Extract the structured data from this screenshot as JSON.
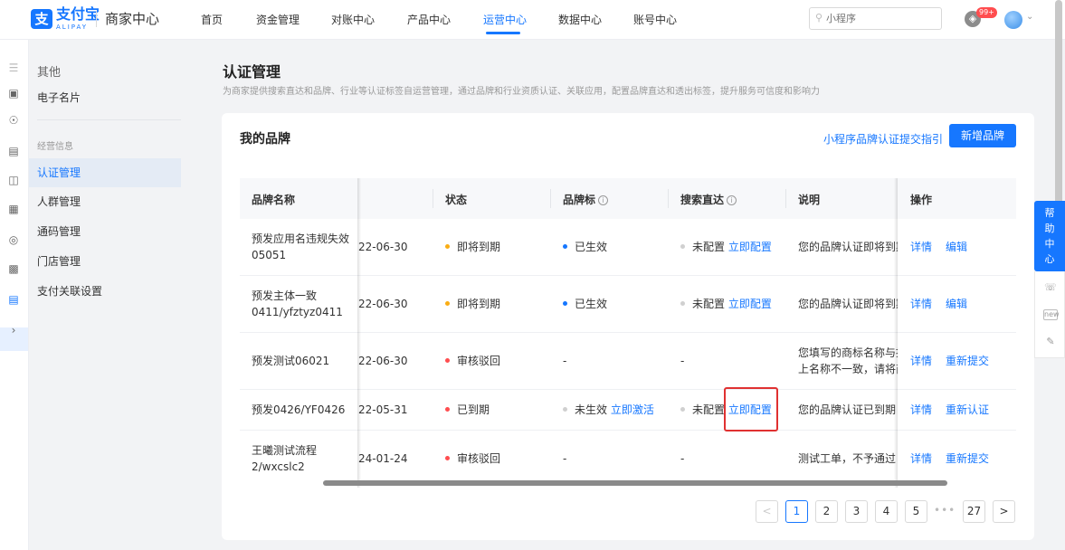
{
  "brand": {
    "logo_glyph": "支",
    "logo_name": "支付宝",
    "logo_sub": "ALIPAY",
    "console": "商家中心"
  },
  "nav": {
    "items": [
      "首页",
      "资金管理",
      "对账中心",
      "产品中心",
      "运营中心",
      "数据中心",
      "账号中心"
    ],
    "active": "运营中心",
    "search_placeholder": "小程序",
    "notification_badge": "99+"
  },
  "sidebar": {
    "header": "其他",
    "top_item": "电子名片",
    "group_label": "经营信息",
    "items": [
      "认证管理",
      "人群管理",
      "通码管理",
      "门店管理",
      "支付关联设置"
    ],
    "active": "认证管理"
  },
  "page": {
    "title": "认证管理",
    "description": "为商家提供搜索直达和品牌、行业等认证标签自运营管理，通过品牌和行业资质认证、关联应用，配置品牌直达和透出标签，提升服务可信度和影响力"
  },
  "card": {
    "title": "我的品牌",
    "guide_link": "小程序品牌认证提交指引",
    "add_button": "新增品牌"
  },
  "table": {
    "headers": {
      "name": "品牌名称",
      "status": "状态",
      "badge": "品牌标",
      "search": "搜索直达",
      "note": "说明",
      "ops": "操作"
    },
    "rows": [
      {
        "name1": "预发应用名违规失效",
        "name2": "05051",
        "date": "22-06-30",
        "status": "即将到期",
        "badge_status": "已生效",
        "badge_action": "",
        "search_status": "未配置",
        "search_action": "立即配置",
        "note1": "您的品牌认证即将到期",
        "note2": "",
        "op1": "详情",
        "op2": "编辑"
      },
      {
        "name1": "预发主体一致",
        "name2": "0411/yfztyz0411",
        "date": "22-06-30",
        "status": "即将到期",
        "badge_status": "已生效",
        "badge_action": "",
        "search_status": "未配置",
        "search_action": "立即配置",
        "note1": "您的品牌认证即将到期",
        "note2": "",
        "op1": "详情",
        "op2": "编辑"
      },
      {
        "name1": "预发测试06021",
        "name2": "",
        "date": "22-06-30",
        "status": "审核驳回",
        "badge_status": "-",
        "badge_action": "",
        "search_status": "-",
        "search_action": "",
        "note1": "您填写的商标名称与提",
        "note2": "上名称不一致，请将商",
        "op1": "详情",
        "op2": "重新提交"
      },
      {
        "name1": "预发0426/YF0426",
        "name2": "",
        "date": "22-05-31",
        "status": "已到期",
        "badge_status": "未生效",
        "badge_action": "立即激活",
        "search_status": "未配置",
        "search_action": "立即配置",
        "note1": "您的品牌认证已到期",
        "note2": "",
        "op1": "详情",
        "op2": "重新认证"
      },
      {
        "name1": "王曦测试流程",
        "name2": "2/wxcslc2",
        "date": "24-01-24",
        "status": "审核驳回",
        "badge_status": "-",
        "badge_action": "",
        "search_status": "-",
        "search_action": "",
        "note1": "测试工单，不予通过",
        "note2": "",
        "op1": "详情",
        "op2": "重新提交"
      }
    ]
  },
  "pagination": {
    "prev": "<",
    "pages": [
      "1",
      "2",
      "3",
      "4",
      "5"
    ],
    "ellipsis": "•••",
    "last": "27",
    "next": ">",
    "current": "1"
  },
  "help": {
    "label_chars": [
      "帮",
      "助",
      "中",
      "心"
    ],
    "new_tag": "new"
  },
  "icons": {
    "bell": "bell-icon",
    "search": "search-icon",
    "help": "headset-icon",
    "edit": "pencil-icon"
  },
  "colors": {
    "accent": "#1677ff",
    "warning": "#faad14",
    "error": "#ff4d4f",
    "highlight": "#e03131"
  }
}
